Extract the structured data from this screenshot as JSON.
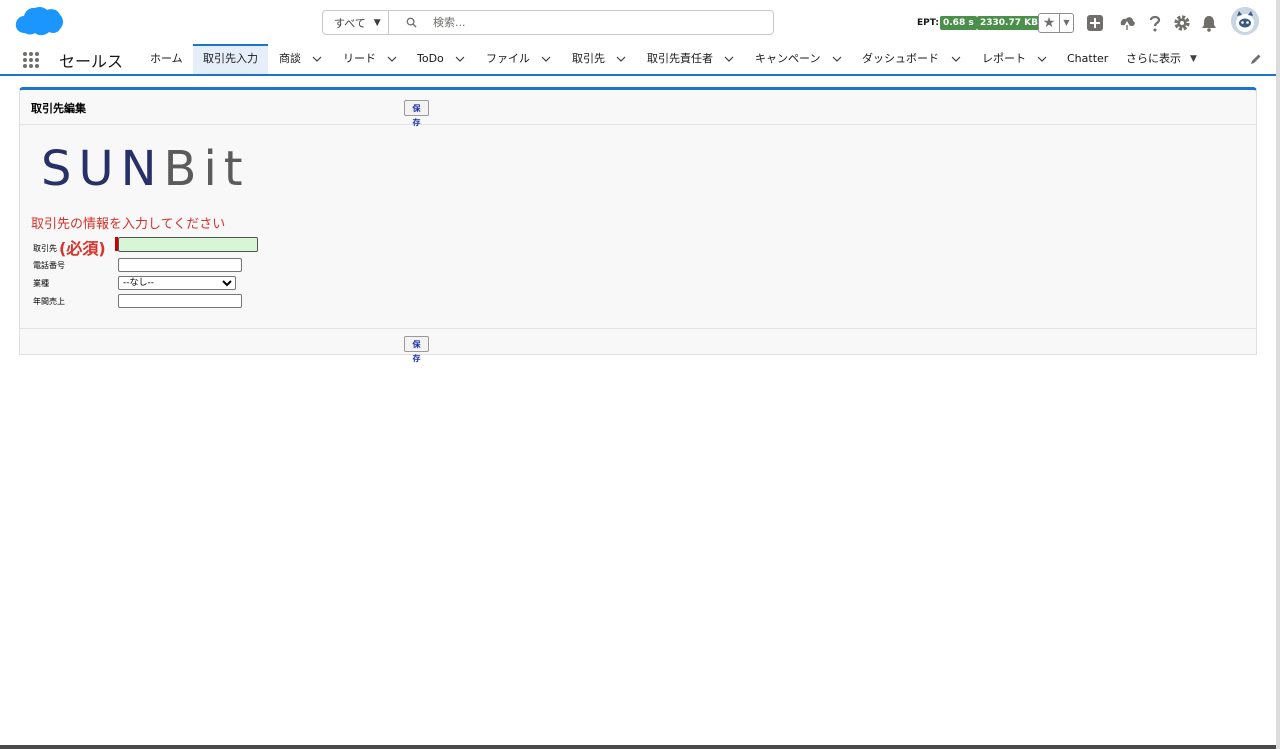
{
  "header": {
    "search": {
      "scope_label": "すべて",
      "placeholder": "検索..."
    },
    "ept": {
      "label": "EPT:",
      "time": "0.68 s",
      "size": "2330.77 KB"
    },
    "icons": [
      "favorites-star-icon",
      "global-actions-add-icon",
      "trailhead-icon",
      "help-icon",
      "setup-gear-icon",
      "notifications-bell-icon"
    ]
  },
  "nav": {
    "app_name": "セールス",
    "items": [
      {
        "label": "ホーム",
        "has_menu": false
      },
      {
        "label": "取引先入力",
        "has_menu": false,
        "active": true
      },
      {
        "label": "商談",
        "has_menu": true
      },
      {
        "label": "リード",
        "has_menu": true
      },
      {
        "label": "ToDo",
        "has_menu": true
      },
      {
        "label": "ファイル",
        "has_menu": true
      },
      {
        "label": "取引先",
        "has_menu": true
      },
      {
        "label": "取引先責任者",
        "has_menu": true
      },
      {
        "label": "キャンペーン",
        "has_menu": true
      },
      {
        "label": "ダッシュボード",
        "has_menu": true
      },
      {
        "label": "レポート",
        "has_menu": true
      },
      {
        "label": "Chatter",
        "has_menu": false
      },
      {
        "label": "さらに表示",
        "has_menu": true
      }
    ]
  },
  "panel": {
    "title": "取引先編集",
    "save_label": "保存",
    "logo": {
      "part1": "SUN",
      "part2": "Bit"
    },
    "info_text": "取引先の情報を入力してください",
    "fields": [
      {
        "label": "取引先",
        "required_mark": "(必須)",
        "value": ""
      },
      {
        "label": "電話番号",
        "value": ""
      },
      {
        "label": "業種",
        "selected": "--なし--"
      },
      {
        "label": "年間売上",
        "value": ""
      }
    ]
  }
}
